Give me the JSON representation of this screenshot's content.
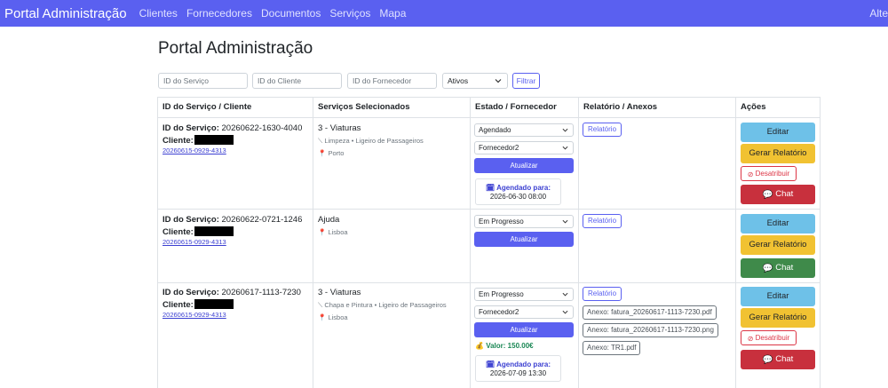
{
  "nav": {
    "brand": "Portal Administração",
    "links": [
      "Clientes",
      "Fornecedores",
      "Documentos",
      "Serviços",
      "Mapa"
    ],
    "right": "Alte"
  },
  "page_title": "Portal Administração",
  "filters": {
    "service_placeholder": "ID do Serviço",
    "client_placeholder": "ID do Cliente",
    "supplier_placeholder": "ID do Fornecedor",
    "status_value": "Ativos",
    "filter_label": "Filtrar"
  },
  "table": {
    "headers": [
      "ID do Serviço / Cliente",
      "Serviços Selecionados",
      "Estado / Fornecedor",
      "Relatório / Anexos",
      "Ações"
    ],
    "labels": {
      "service_id": "ID do Serviço:",
      "client": "Cliente:",
      "update": "Atualizar",
      "scheduled_for": "Agendado para:",
      "report": "Relatório",
      "edit": "Editar",
      "generate_report": "Gerar Relatório",
      "unassign": "Desatribuir",
      "chat": "Chat",
      "value_prefix": "Valor:"
    },
    "rows": [
      {
        "service_id": "20260622-1630-4040",
        "client_link": "20260615-0929-4313",
        "services_title": "3 - Viaturas",
        "services_detail": "Limpeza • Ligeiro de Passageiros",
        "location": "Porto",
        "status": "Agendado",
        "supplier": "Fornecedor2",
        "scheduled": "2026-06-30 08:00",
        "attachments": []
      },
      {
        "service_id": "20260622-0721-1246",
        "client_link": "20260615-0929-4313",
        "services_title": "Ajuda",
        "location": "Lisboa",
        "status": "Em Progresso",
        "attachments": []
      },
      {
        "service_id": "20260617-1113-7230",
        "client_link": "20260615-0929-4313",
        "services_title": "3 - Viaturas",
        "services_detail": "Chapa e Pintura • Ligeiro de Passageiros",
        "location": "Lisboa",
        "status": "Em Progresso",
        "supplier": "Fornecedor2",
        "value": "150.00€",
        "scheduled": "2026-07-09 13:30",
        "attachments": [
          "Anexo: fatura_20260617-1113-7230.pdf",
          "Anexo: fatura_20260617-1113-7230.png",
          "Anexo: TR1.pdf"
        ]
      }
    ]
  },
  "colors": {
    "navbar": "#5a60f0",
    "primary": "#5a60f0",
    "edit": "#6ec1e8",
    "generate": "#f1c232",
    "chat_red": "#c8303d",
    "chat_green": "#3f8a4a",
    "danger": "#dc3545"
  },
  "icons": [
    "calendar-icon",
    "pin-icon",
    "wrench-icon",
    "ban-icon",
    "chat-icon",
    "money-bag-icon",
    "chevron-down-icon"
  ]
}
